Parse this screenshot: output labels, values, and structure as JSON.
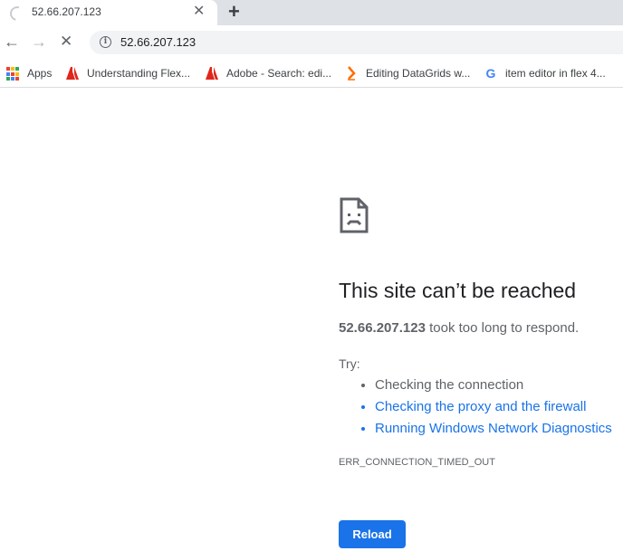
{
  "tab": {
    "title": "52.66.207.123",
    "close_glyph": "✕",
    "new_tab_glyph": "+"
  },
  "toolbar": {
    "back_glyph": "←",
    "forward_glyph": "→",
    "stop_glyph": "✕",
    "url": "52.66.207.123"
  },
  "bookmarks": [
    {
      "label": "Apps",
      "icon": "apps-grid-icon"
    },
    {
      "label": "Understanding Flex...",
      "icon": "adobe-icon"
    },
    {
      "label": "Adobe - Search: edi...",
      "icon": "adobe-icon"
    },
    {
      "label": "Editing DataGrids w...",
      "icon": "orange-arrow-icon"
    },
    {
      "label": "item editor in flex 4...",
      "icon": "google-icon"
    }
  ],
  "error": {
    "title": "This site can’t be reached",
    "host": "52.66.207.123",
    "desc_suffix": " took too long to respond.",
    "try_label": "Try:",
    "suggestions": [
      {
        "text": "Checking the connection",
        "link": false
      },
      {
        "text": "Checking the proxy and the firewall",
        "link": true
      },
      {
        "text": "Running Windows Network Diagnostics",
        "link": true
      }
    ],
    "code": "ERR_CONNECTION_TIMED_OUT",
    "reload_label": "Reload"
  },
  "colors": {
    "accent": "#1a73e8",
    "text": "#202124",
    "muted": "#5f6368",
    "adobe_red": "#e1251b"
  }
}
